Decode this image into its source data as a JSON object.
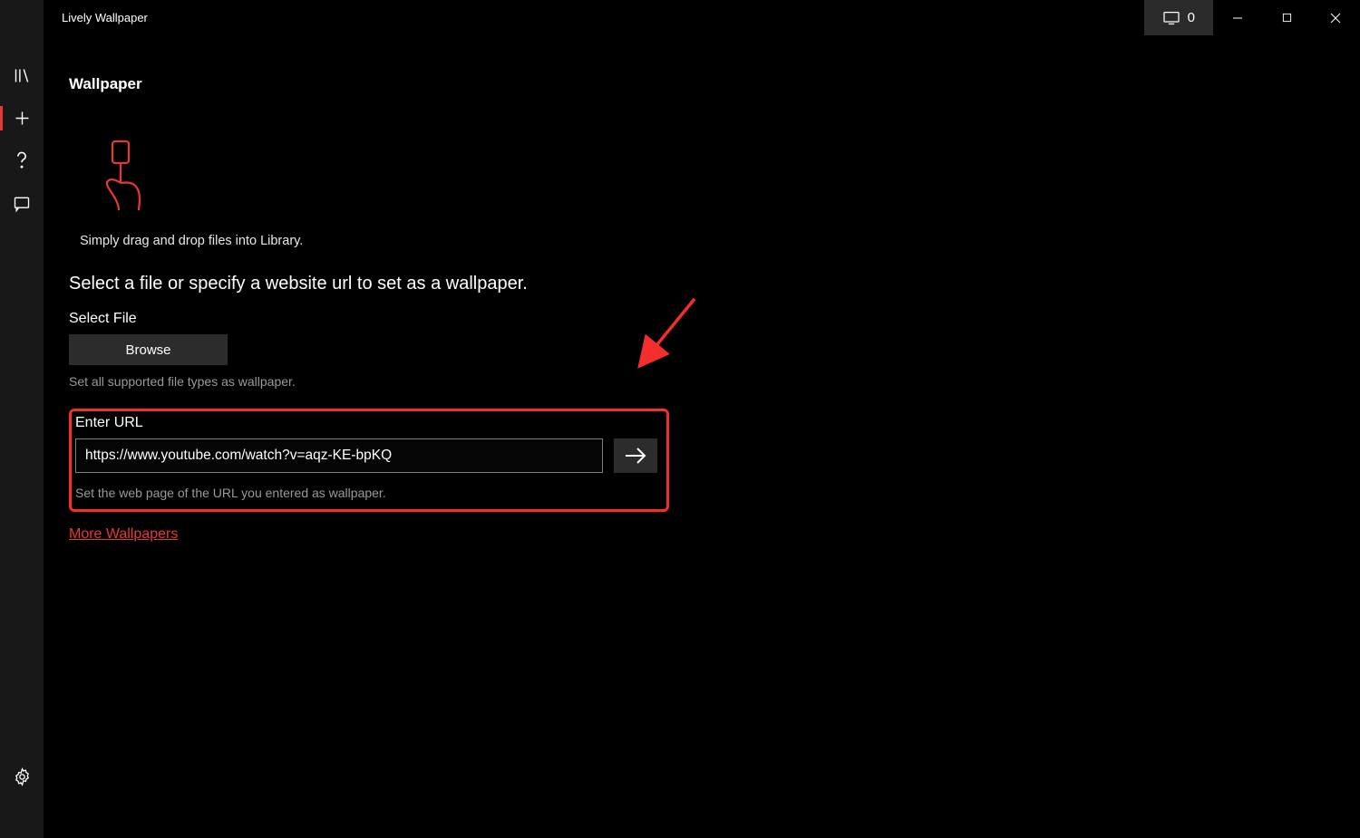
{
  "titlebar": {
    "app_name": "Lively Wallpaper",
    "monitor_count": "0"
  },
  "sidebar": {
    "items": [
      {
        "name": "library",
        "active": false
      },
      {
        "name": "add",
        "active": true
      },
      {
        "name": "help",
        "active": false
      },
      {
        "name": "feedback",
        "active": false
      }
    ],
    "footer_item": {
      "name": "settings"
    }
  },
  "page": {
    "title": "Wallpaper",
    "drag_hint": "Simply drag and drop files into Library.",
    "instruction": "Select a file or specify a website url to set as a wallpaper.",
    "select_file_label": "Select File",
    "browse_label": "Browse",
    "file_hint": "Set all supported file types as wallpaper.",
    "enter_url_label": "Enter URL",
    "url_value": "https://www.youtube.com/watch?v=aqz-KE-bpKQ",
    "url_hint": "Set the web page of the URL you entered as wallpaper.",
    "more_link": "More Wallpapers"
  },
  "annotation": {
    "color": "#f62d2d"
  }
}
